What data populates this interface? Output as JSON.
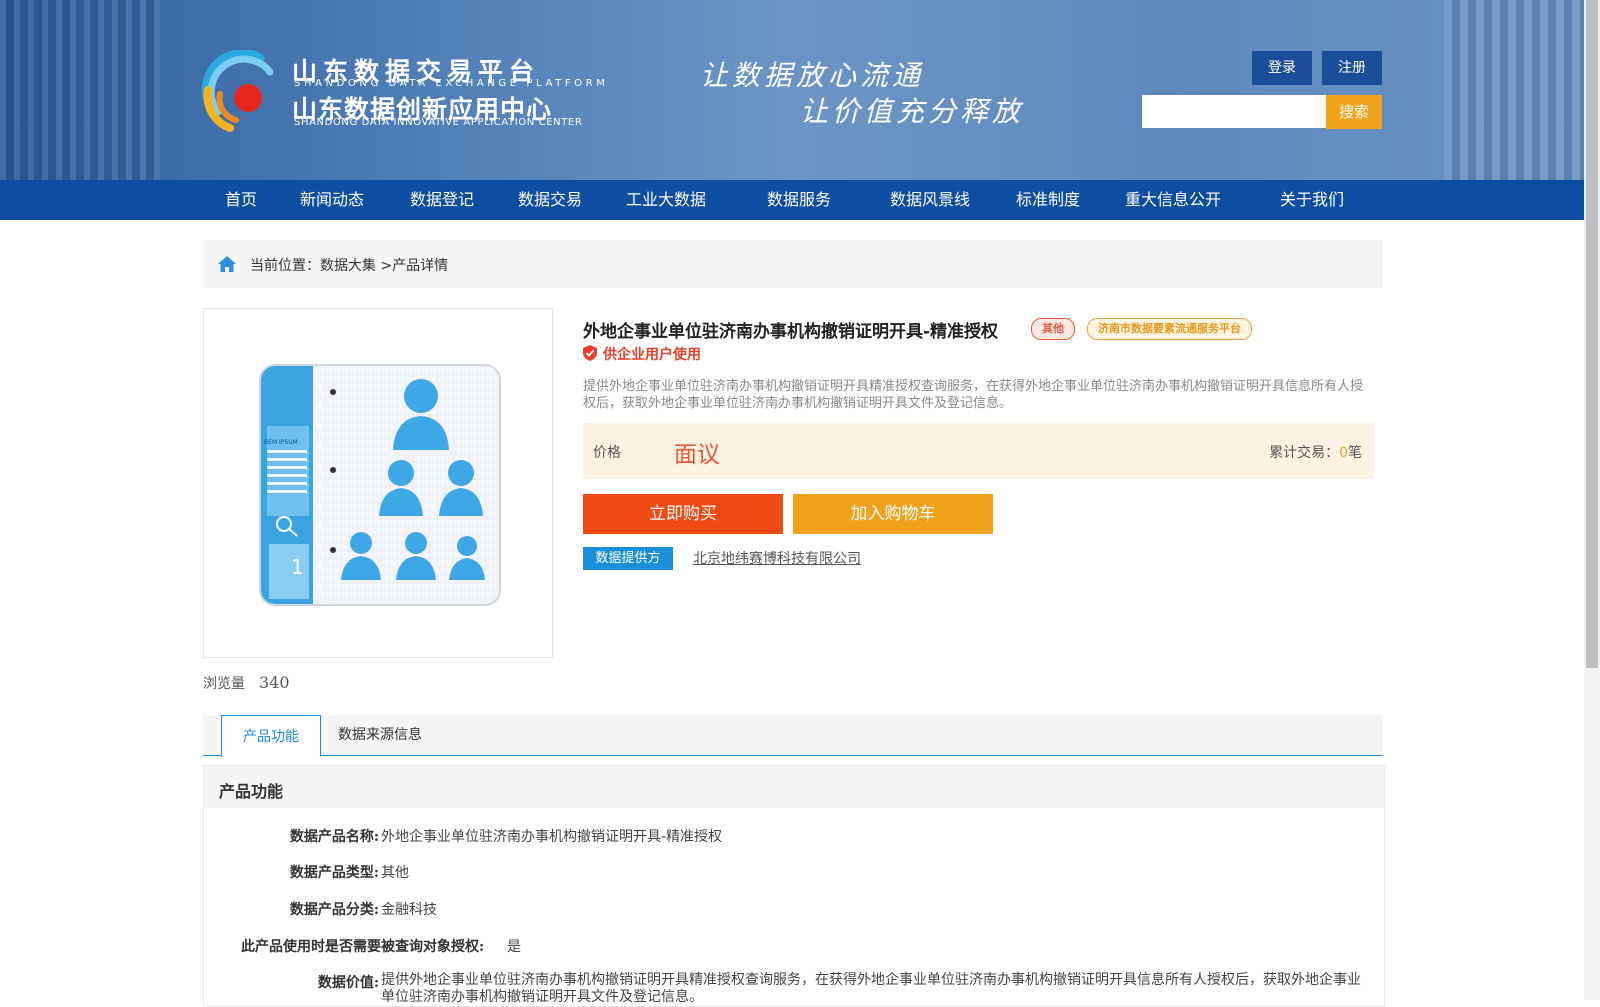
{
  "header": {
    "logo": {
      "line1": "山东数据交易平台",
      "line1_en": "SHANDONG DATA EXCHANGE PLATFORM",
      "line2": "山东数据创新应用中心",
      "line2_en": "SHANDONG DATA INNOVATIVE APPLICATION CENTER"
    },
    "slogan_line1": "让数据放心流通",
    "slogan_line2": "让价值充分释放",
    "login_label": "登录",
    "register_label": "注册",
    "search": {
      "value": "",
      "button_label": "搜索"
    }
  },
  "nav": {
    "items": [
      {
        "label": "首页"
      },
      {
        "label": "新闻动态"
      },
      {
        "label": "数据登记"
      },
      {
        "label": "数据交易"
      },
      {
        "label": "工业大数据"
      },
      {
        "label": "数据服务"
      },
      {
        "label": "数据风景线"
      },
      {
        "label": "标准制度"
      },
      {
        "label": "重大信息公开"
      },
      {
        "label": "关于我们"
      }
    ]
  },
  "breadcrumb": {
    "prefix": "当前位置：",
    "level1": "数据大集",
    "separator": ">",
    "level2": "产品详情"
  },
  "product": {
    "title": "外地企事业单位驻济南办事机构撤销证明开具-精准授权",
    "tag_type": "其他",
    "tag_platform": "济南市数据要素流通服务平台",
    "enterprise_only": "供企业用户使用",
    "description": "提供外地企事业单位驻济南办事机构撤销证明开具精准授权查询服务，在获得外地企事业单位驻济南办事机构撤销证明开具信息所有人授权后，获取外地企事业单位驻济南办事机构撤销证明开具文件及登记信息。",
    "price_label": "价格",
    "price_value": "面议",
    "trades_label": "累计交易：",
    "trades_count": "0",
    "trades_unit": "笔",
    "buy_label": "立即购买",
    "cart_label": "加入购物车",
    "provider_label": "数据提供方",
    "provider_name": "北京地纬赛博科技有限公司",
    "views_label": "浏览量",
    "views_count": "340",
    "image_caption": "REM IPSUM"
  },
  "tabs": [
    {
      "label": "产品功能",
      "active": true
    },
    {
      "label": "数据来源信息",
      "active": false
    }
  ],
  "section": {
    "title": "产品功能",
    "rows": [
      {
        "label": "数据产品名称:",
        "value": "外地企事业单位驻济南办事机构撤销证明开具-精准授权"
      },
      {
        "label": "数据产品类型:",
        "value": "其他"
      },
      {
        "label": "数据产品分类:",
        "value": "金融科技"
      },
      {
        "label": "此产品使用时是否需要被查询对象授权:",
        "value": "是"
      },
      {
        "label": "数据价值:",
        "value": "提供外地企事业单位驻济南办事机构撤销证明开具精准授权查询服务，在获得外地企事业单位驻济南办事机构撤销证明开具信息所有人授权后，获取外地企事业单位驻济南办事机构撤销证明开具文件及登记信息。"
      }
    ]
  },
  "colors": {
    "nav_bg": "#0d4ea0",
    "accent_blue": "#1a8fd7",
    "buy_orange": "#ef4a14",
    "cart_orange": "#f0a21b",
    "price_red": "#e8583b"
  }
}
